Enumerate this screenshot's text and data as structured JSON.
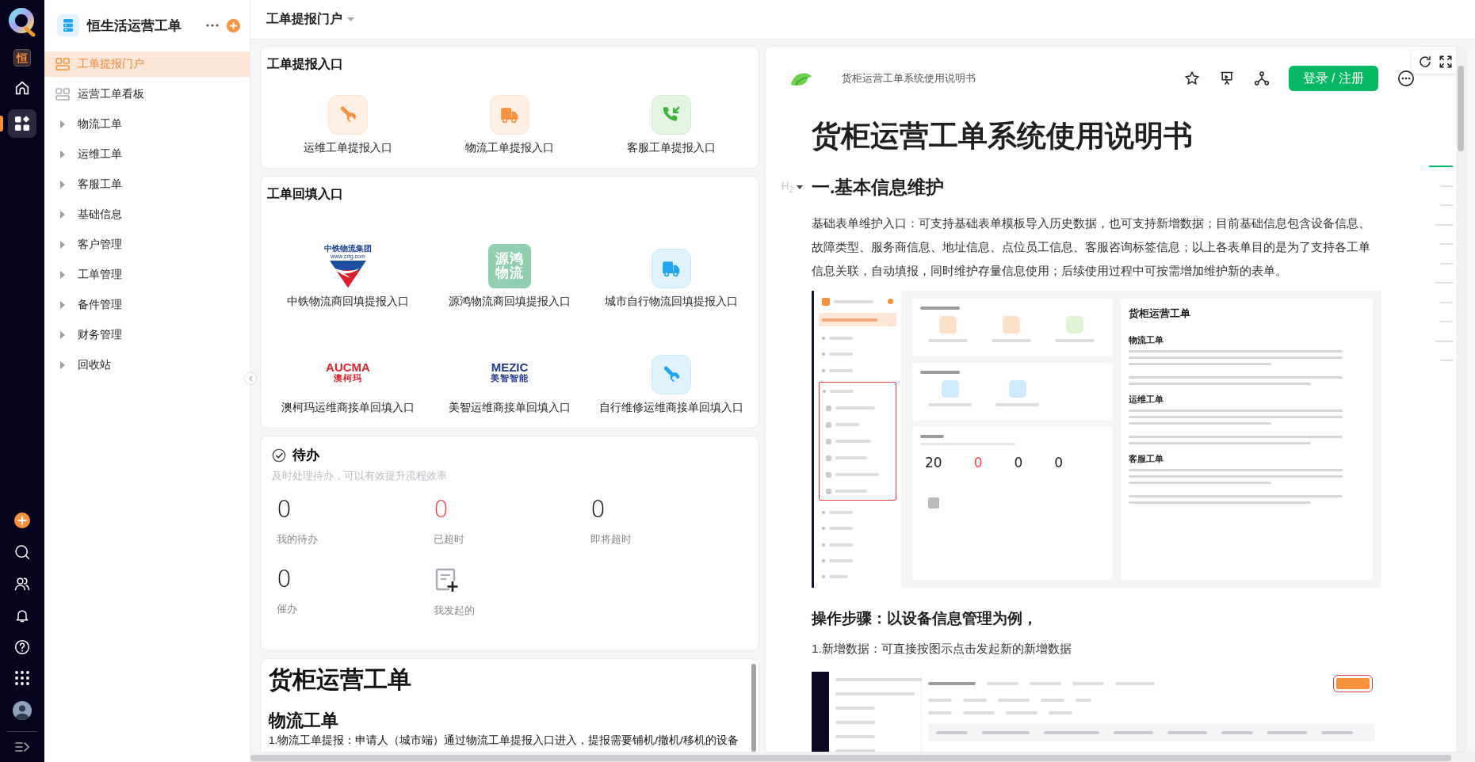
{
  "rail": {
    "top": [
      {
        "kind": "logo",
        "selected": false
      },
      {
        "kind": "app",
        "label": "恒",
        "selected": false
      },
      {
        "kind": "home",
        "selected": false
      },
      {
        "kind": "apps",
        "selected": true
      }
    ],
    "bottom": [
      {
        "kind": "add",
        "selected": false
      },
      {
        "kind": "search",
        "selected": false
      },
      {
        "kind": "people",
        "selected": false
      },
      {
        "kind": "bell",
        "selected": false
      },
      {
        "kind": "help",
        "selected": false
      },
      {
        "kind": "grid",
        "selected": false
      },
      {
        "kind": "avatar",
        "selected": false
      },
      {
        "kind": "collapse",
        "selected": false
      }
    ]
  },
  "sidebar": {
    "title": "恒生活运营工单",
    "items": [
      {
        "label": "工单提报门户",
        "kind": "page",
        "selected": true
      },
      {
        "label": "运营工单看板",
        "kind": "page",
        "selected": false
      },
      {
        "label": "物流工单",
        "kind": "folder",
        "expanded": false,
        "selected": false
      },
      {
        "label": "运维工单",
        "kind": "folder",
        "expanded": false,
        "selected": false
      },
      {
        "label": "客服工单",
        "kind": "folder",
        "expanded": false,
        "selected": false
      },
      {
        "label": "基础信息",
        "kind": "folder",
        "expanded": false,
        "selected": false
      },
      {
        "label": "客户管理",
        "kind": "folder",
        "expanded": false,
        "selected": false
      },
      {
        "label": "工单管理",
        "kind": "folder",
        "expanded": false,
        "selected": false
      },
      {
        "label": "备件管理",
        "kind": "folder",
        "expanded": false,
        "selected": false
      },
      {
        "label": "财务管理",
        "kind": "folder",
        "expanded": false,
        "selected": false
      },
      {
        "label": "回收站",
        "kind": "folder",
        "expanded": false,
        "selected": false
      }
    ]
  },
  "header": {
    "title": "工单提报门户"
  },
  "report_entry": {
    "title": "工单提报入口",
    "items": [
      {
        "label": "运维工单提报入口",
        "kind": "wrench",
        "color": "#f7913d"
      },
      {
        "label": "物流工单提报入口",
        "kind": "truck",
        "color": "#f7913d"
      },
      {
        "label": "客服工单提报入口",
        "kind": "phone",
        "color": "#3fb33a"
      }
    ]
  },
  "backfill_entry": {
    "title": "工单回填入口",
    "items": [
      {
        "label": "中铁物流商回填提报入口",
        "kind": "crtg",
        "logo": [
          "中铁物流集团",
          "www.crtg.com"
        ]
      },
      {
        "label": "源鸿物流商回填提报入口",
        "kind": "text-tile",
        "logo": [
          "源鸿",
          "物流"
        ],
        "color": "#8fcfad"
      },
      {
        "label": "城市自行物流回填提报入口",
        "kind": "truck",
        "color": "#1fa6f0"
      },
      {
        "label": "澳柯玛运维商接单回填入口",
        "kind": "wordmark",
        "logo": [
          "AUCMA",
          "澳柯玛"
        ],
        "color": "#e1232b"
      },
      {
        "label": "美智运维商接单回填入口",
        "kind": "wordmark",
        "logo": [
          "MEZIC",
          "美智智能"
        ],
        "color": "#23378c"
      },
      {
        "label": "自行维修运维商接单回填入口",
        "kind": "wrench",
        "color": "#1fa6f0"
      }
    ]
  },
  "todo": {
    "title": "待办",
    "subtitle": "及时处理待办，可以有效提升流程效率",
    "stats": [
      {
        "kind": "count",
        "value": "0",
        "label": "我的待办",
        "alert": false
      },
      {
        "kind": "count",
        "value": "0",
        "label": "已超时",
        "alert": true
      },
      {
        "kind": "count",
        "value": "0",
        "label": "即将超时",
        "alert": false
      },
      {
        "kind": "count",
        "value": "0",
        "label": "催办",
        "alert": false
      },
      {
        "kind": "action",
        "label": "我发起的"
      }
    ]
  },
  "preview": {
    "title": "货柜运营工单",
    "section": "物流工单",
    "text": "1.物流工单提报：申请人（城市端）通过物流工单提报入口进入，提报需要铺机/撤机/移机的设备"
  },
  "doc": {
    "name": "货柜运营工单系统使用说明书",
    "login": "登录 / 注册",
    "title": "货柜运营工单系统使用说明书",
    "heading_tag": "H$_{2}$",
    "heading": "一.基本信息维护",
    "paragraph": "基础表单维护入口：可支持基础表单模板导入历史数据，也可支持新增数据；目前基础信息包含设备信息、故障类型、服务商信息、地址信息、点位员工信息、客服咨询标签信息；以上各表单目的是为了支持各工单信息关联，自动填报，同时维护存量信息使用；后续使用过程中可按需增加维护新的表单。",
    "screenshot_1": {
      "kind": "portal",
      "doc_title": "货柜运营工单",
      "sections": [
        "物流工单",
        "运维工单",
        "客服工单"
      ],
      "counts": [
        {
          "value": "20",
          "alert": false
        },
        {
          "value": "0",
          "alert": true
        },
        {
          "value": "0",
          "alert": false
        },
        {
          "value": "0",
          "alert": false
        }
      ]
    },
    "step_heading": "操作步骤：以设备信息管理为例，",
    "step": "1.新增数据：可直接按图示点击发起新的新增数据",
    "screenshot_2": {
      "kind": "list"
    },
    "outline": [
      {
        "selected": true
      },
      {
        "selected": false
      },
      {
        "selected": false
      },
      {
        "selected": false
      },
      {
        "selected": false
      },
      {
        "selected": false
      },
      {
        "selected": false
      },
      {
        "selected": false
      },
      {
        "selected": false
      },
      {
        "selected": false
      },
      {
        "selected": false
      }
    ]
  }
}
